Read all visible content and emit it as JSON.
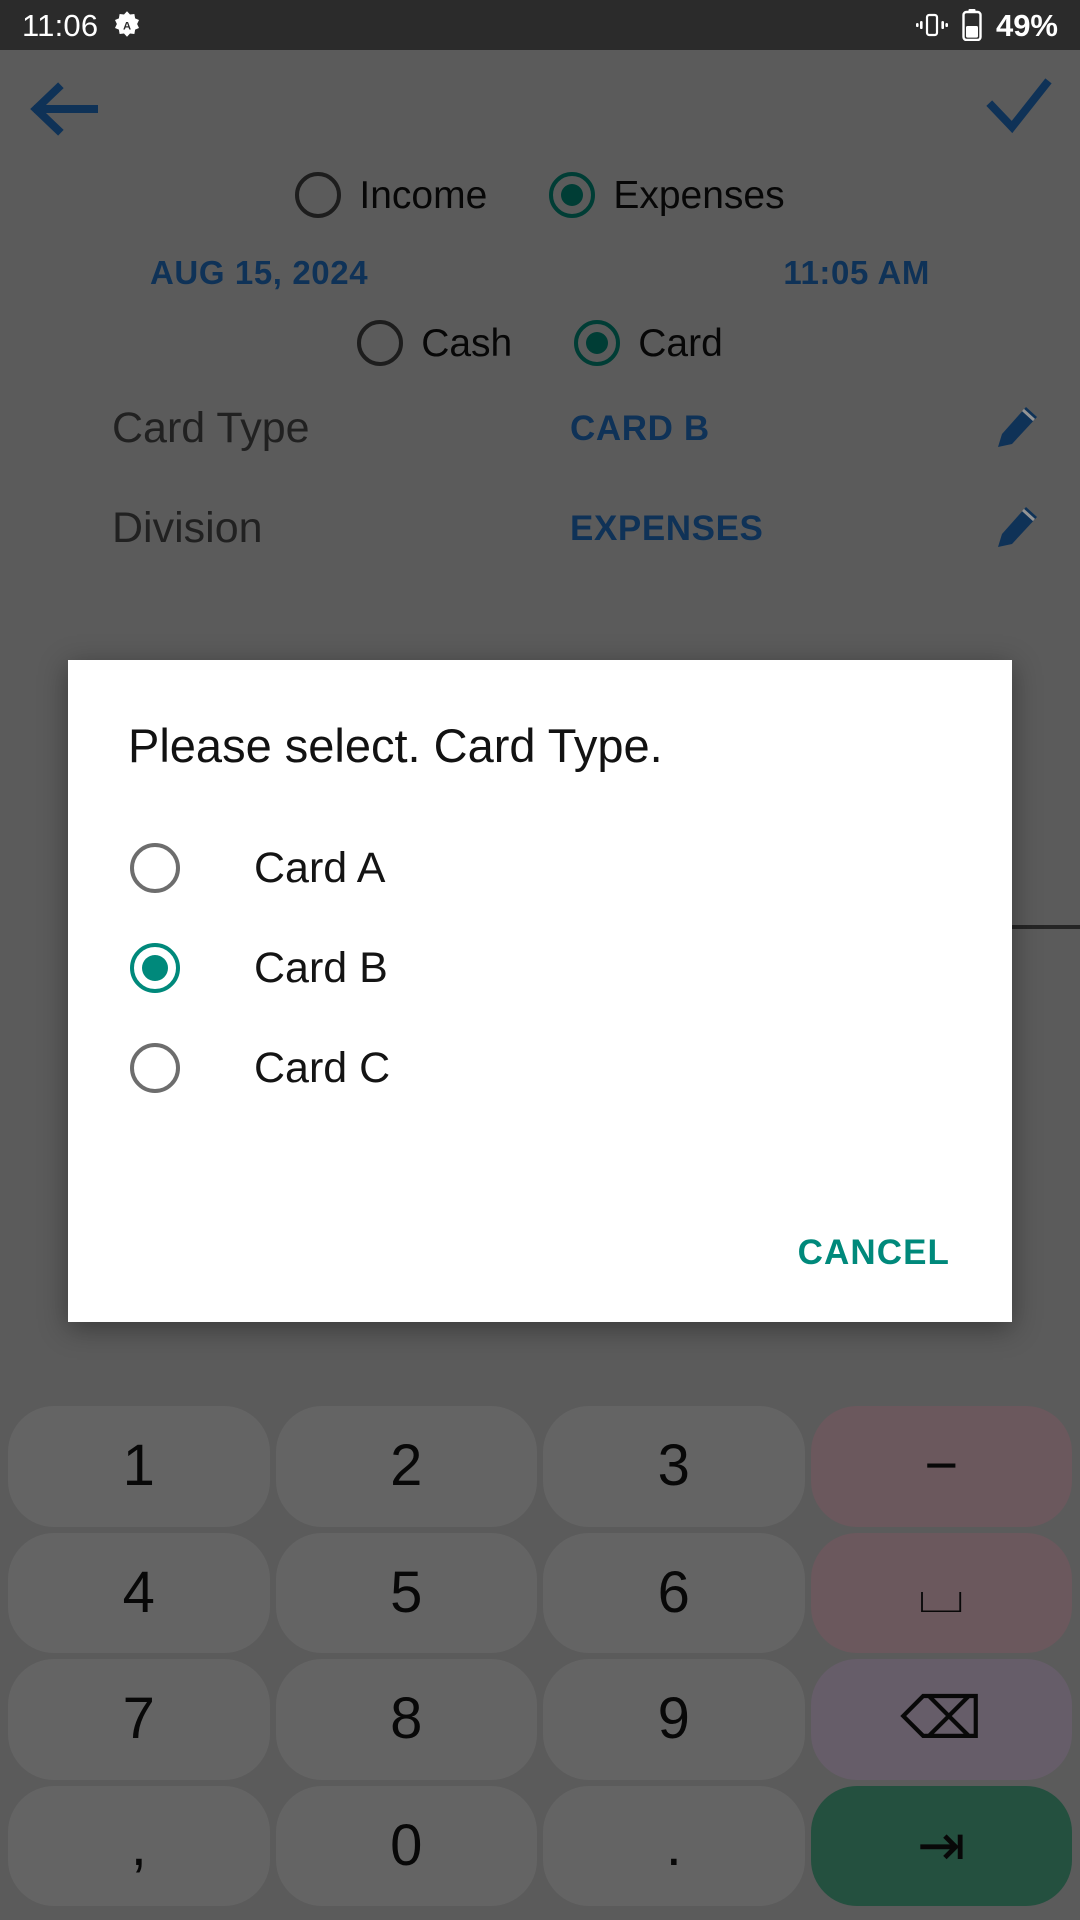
{
  "status_bar": {
    "time": "11:06",
    "app_badge_icon": "adaptive-brightness-icon",
    "vibrate_icon": "vibrate-icon",
    "battery_icon": "battery-icon",
    "battery_percent": "49%"
  },
  "app_bar": {
    "back_icon": "back-arrow-icon",
    "confirm_icon": "checkmark-icon",
    "accent_color": "#1a5796"
  },
  "form": {
    "type_options": [
      {
        "label": "Income",
        "selected": false
      },
      {
        "label": "Expenses",
        "selected": true
      }
    ],
    "date": "AUG 15, 2024",
    "time": "11:05 AM",
    "payment_options": [
      {
        "label": "Cash",
        "selected": false
      },
      {
        "label": "Card",
        "selected": true
      }
    ],
    "fields": [
      {
        "label": "Card Type",
        "value": "CARD B",
        "edit_icon": "pencil-icon"
      },
      {
        "label": "Division",
        "value": "EXPENSES",
        "edit_icon": "pencil-icon"
      }
    ],
    "selected_color": "#00695c"
  },
  "dialog": {
    "title": "Please select. Card Type.",
    "options": [
      {
        "label": "Card A",
        "selected": false
      },
      {
        "label": "Card B",
        "selected": true
      },
      {
        "label": "Card C",
        "selected": false
      }
    ],
    "cancel_label": "CANCEL",
    "accent_color": "#00897b"
  },
  "keypad": {
    "keys": [
      {
        "label": "1",
        "name": "key-1",
        "style": "num"
      },
      {
        "label": "2",
        "name": "key-2",
        "style": "num"
      },
      {
        "label": "3",
        "name": "key-3",
        "style": "num"
      },
      {
        "label": "−",
        "name": "key-minus",
        "style": "fn"
      },
      {
        "label": "4",
        "name": "key-4",
        "style": "num"
      },
      {
        "label": "5",
        "name": "key-5",
        "style": "num"
      },
      {
        "label": "6",
        "name": "key-6",
        "style": "num"
      },
      {
        "label": "⌴",
        "name": "key-space",
        "style": "fn"
      },
      {
        "label": "7",
        "name": "key-7",
        "style": "num"
      },
      {
        "label": "8",
        "name": "key-8",
        "style": "num"
      },
      {
        "label": "9",
        "name": "key-9",
        "style": "num"
      },
      {
        "label": "⌫",
        "name": "key-backspace",
        "style": "fn2"
      },
      {
        "label": ",",
        "name": "key-comma",
        "style": "num"
      },
      {
        "label": "0",
        "name": "key-0",
        "style": "num"
      },
      {
        "label": ".",
        "name": "key-period",
        "style": "num"
      },
      {
        "label": "⇥",
        "name": "key-next",
        "style": "ok"
      }
    ]
  }
}
